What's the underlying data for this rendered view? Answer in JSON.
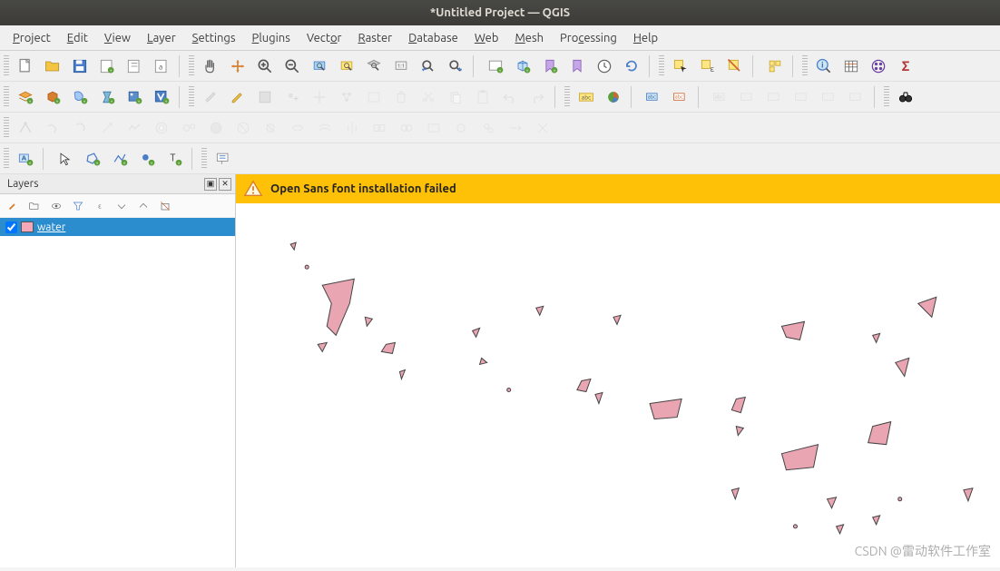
{
  "window": {
    "title": "*Untitled Project — QGIS"
  },
  "menu": {
    "project": "Project",
    "edit": "Edit",
    "view": "View",
    "layer": "Layer",
    "settings": "Settings",
    "plugins": "Plugins",
    "vector": "Vector",
    "raster": "Raster",
    "database": "Database",
    "web": "Web",
    "mesh": "Mesh",
    "processing": "Processing",
    "help": "Help"
  },
  "panels": {
    "layers": {
      "title": "Layers",
      "items": [
        {
          "name": "water",
          "checked": true,
          "color": "#f5a9b8"
        }
      ]
    }
  },
  "warning": {
    "message": "Open Sans font installation failed"
  },
  "watermark": "CSDN @雷动软件工作室"
}
